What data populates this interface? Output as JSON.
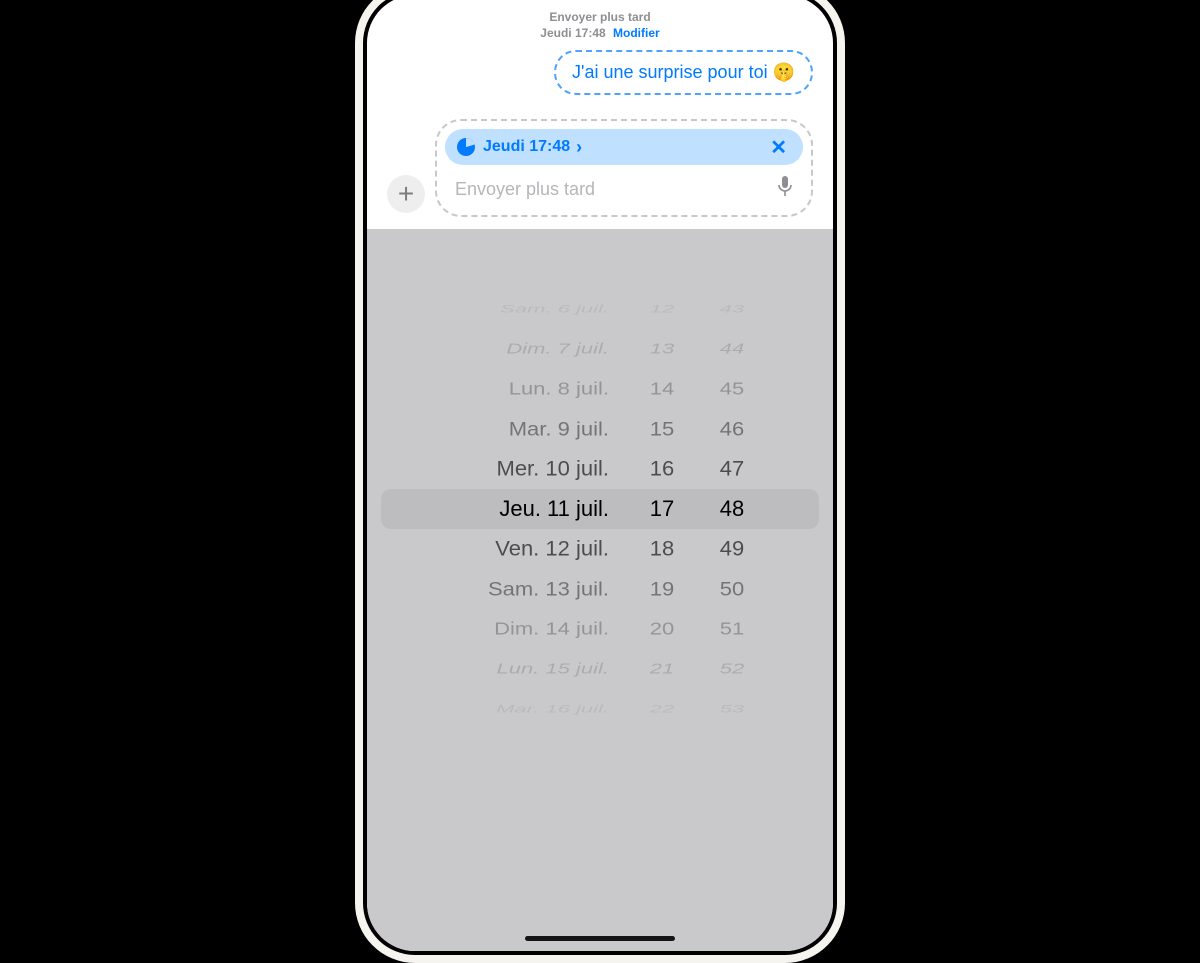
{
  "header": {
    "title": "Envoyer plus tard",
    "datetime": "Jeudi 17:48",
    "edit_label": "Modifier"
  },
  "message": {
    "bubble_text": "J'ai une surprise pour toi 🤫"
  },
  "schedule_pill": {
    "label": "Jeudi 17:48",
    "chevron": "›",
    "close": "✕"
  },
  "compose": {
    "add_glyph": "+",
    "placeholder": "Envoyer plus tard",
    "mic_glyph": "🎤"
  },
  "picker": {
    "dates_before": [
      "Sam. 6 juil.",
      "Dim. 7 juil.",
      "Lun. 8 juil.",
      "Mar. 9 juil.",
      "Mer. 10 juil."
    ],
    "date_selected": "Jeu. 11 juil.",
    "dates_after": [
      "Ven. 12 juil.",
      "Sam. 13 juil.",
      "Dim. 14 juil.",
      "Lun. 15 juil.",
      "Mar. 16 juil."
    ],
    "hours_before": [
      "12",
      "13",
      "14",
      "15",
      "16"
    ],
    "hour_selected": "17",
    "hours_after": [
      "18",
      "19",
      "20",
      "21",
      "22"
    ],
    "mins_before": [
      "43",
      "44",
      "45",
      "46",
      "47"
    ],
    "min_selected": "48",
    "mins_after": [
      "49",
      "50",
      "51",
      "52",
      "53"
    ]
  }
}
